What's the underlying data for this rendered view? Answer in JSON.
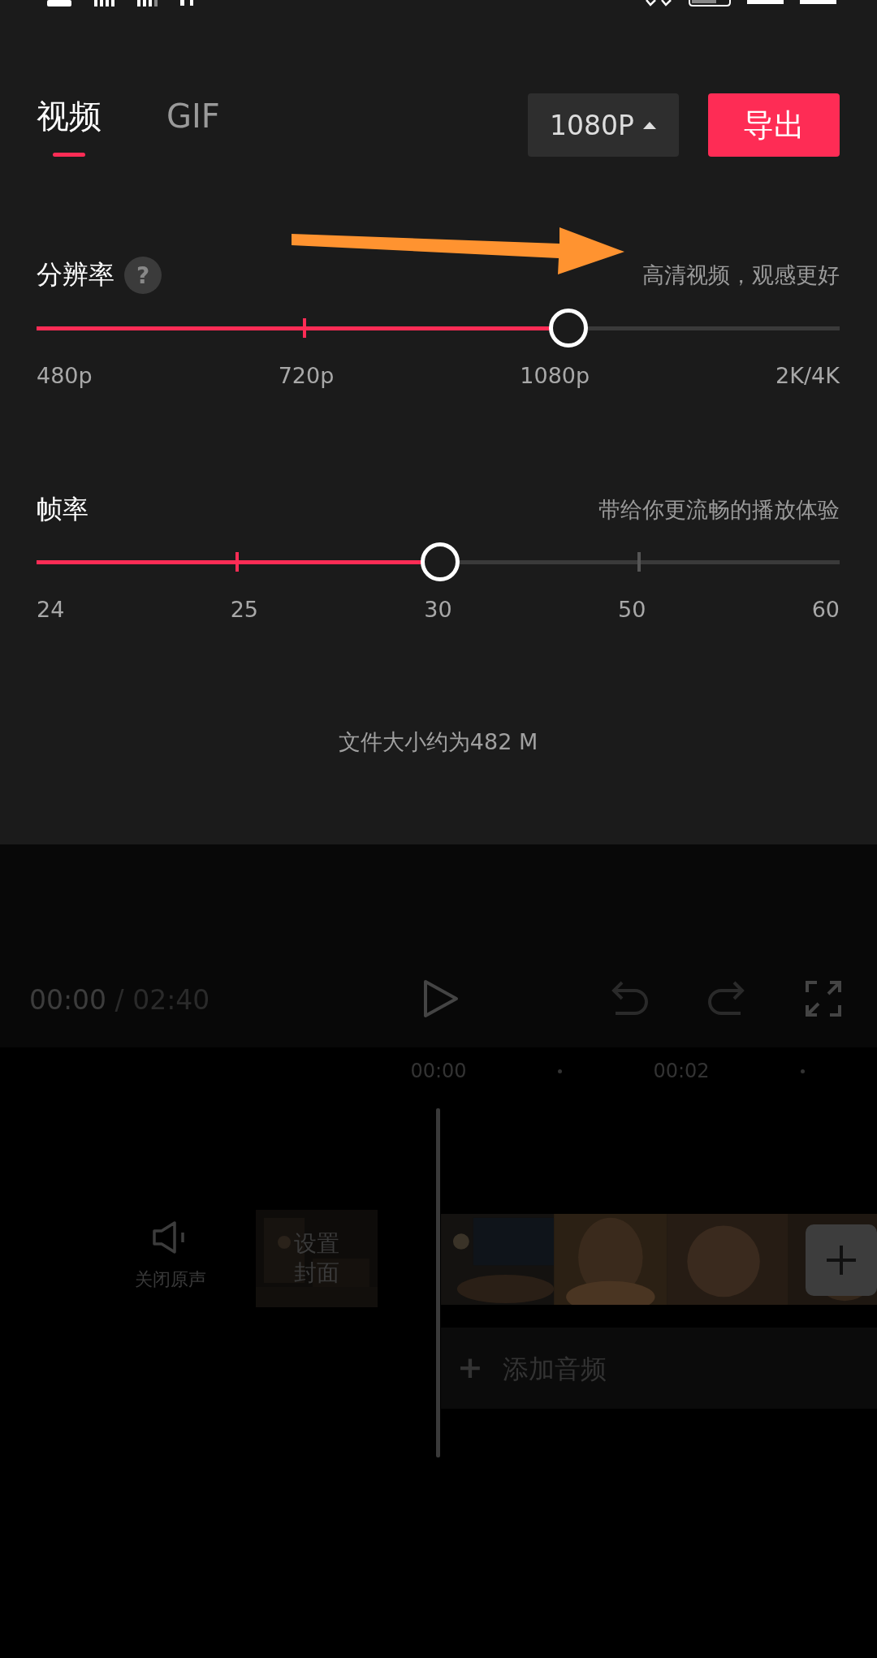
{
  "tabs": [
    {
      "label": "视频",
      "selected": true
    },
    {
      "label": "GIF",
      "selected": false
    }
  ],
  "quality_button": {
    "label": "1080P"
  },
  "export_button": {
    "label": "导出"
  },
  "resolution": {
    "title": "分辨率",
    "help": "?",
    "hint": "高清视频，观感更好",
    "level": 0.66,
    "labels": [
      "480p",
      "720p",
      "1080p",
      "2K/4K"
    ]
  },
  "frame_rate": {
    "title": "帧率",
    "hint": "带给你更流畅的播放体验",
    "level": 0.5,
    "labels": [
      "24",
      "25",
      "30",
      "50",
      "60"
    ]
  },
  "file_size": "文件大小约为482 M",
  "player": {
    "current_time": "00:00",
    "separator": "/",
    "total_time": "02:40"
  },
  "ruler": [
    "00:00",
    "00:02"
  ],
  "mute": {
    "label": "关闭原声"
  },
  "cover": {
    "lines": [
      "设置",
      "封面"
    ]
  },
  "add_audio": {
    "icon": "+",
    "label": "添加音频"
  }
}
